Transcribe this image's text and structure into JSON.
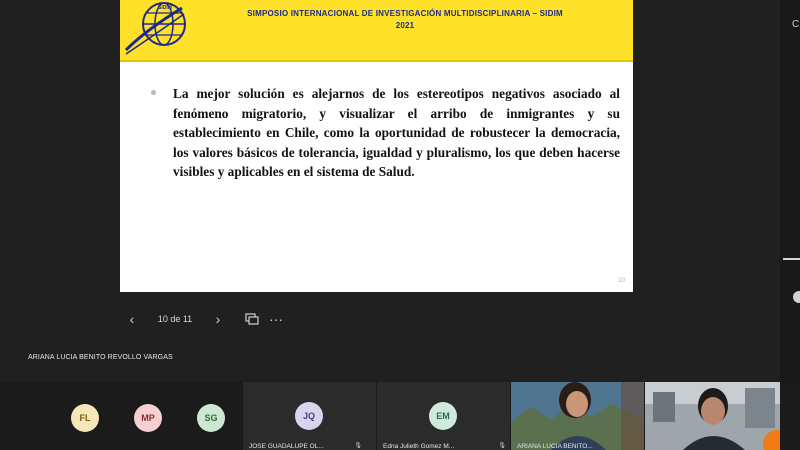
{
  "slide": {
    "banner_line1": "SIMPOSIO INTERNACIONAL DE INVESTIGACIÓN MULTIDISCIPLINARIA – SIDIM",
    "banner_line2": "2021",
    "logo_text": "SIDIM",
    "body": "La mejor solución es alejarnos de los estereotipos negativos asociado al fenómeno migratorio, y visualizar el arribo de inmigrantes y su establecimiento en Chile, como la oportunidad de robustecer la democracia, los valores básicos de tolerancia, igualdad y pluralismo, los que deben hacerse visibles y aplicables en el sistema de Salud.",
    "number": "10"
  },
  "pager": {
    "prev_icon": "‹",
    "count": "10 de 11",
    "next_icon": "›",
    "more_icon": "···"
  },
  "presenter": {
    "name": "ARIANA LUCIA BENITO REVOLLO VARGAS"
  },
  "participants": [
    {
      "initials": "FL",
      "color": "#f6e7b8",
      "text_color": "#7a5c14"
    },
    {
      "initials": "MP",
      "color": "#f5cfd1",
      "text_color": "#8a2d33"
    },
    {
      "initials": "SG",
      "color": "#cde8d2",
      "text_color": "#2c6b3b"
    },
    {
      "initials": "JQ",
      "color": "#d9d4ee",
      "text_color": "#4b3f86",
      "name": "JOSE GUADALUPE OL..."
    },
    {
      "initials": "EM",
      "color": "#cfe9dc",
      "text_color": "#2c6a4c",
      "name": "Edna Julieth Gomez M..."
    },
    {
      "name": "ARIANA LUCIA BENITO..."
    }
  ],
  "right_strip": {
    "top_letter": "C"
  }
}
